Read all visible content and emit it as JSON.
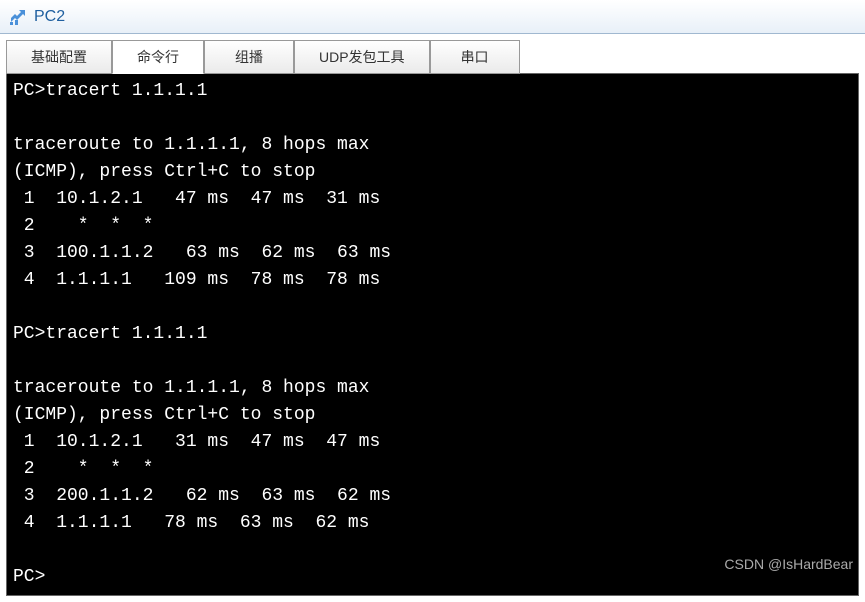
{
  "window": {
    "title": "PC2"
  },
  "tabs": [
    {
      "label": "基础配置",
      "active": false
    },
    {
      "label": "命令行",
      "active": true
    },
    {
      "label": "组播",
      "active": false
    },
    {
      "label": "UDP发包工具",
      "active": false
    },
    {
      "label": "串口",
      "active": false
    }
  ],
  "terminal": {
    "prompt": "PC>",
    "lines": [
      "PC>tracert 1.1.1.1",
      "",
      "traceroute to 1.1.1.1, 8 hops max",
      "(ICMP), press Ctrl+C to stop",
      " 1  10.1.2.1   47 ms  47 ms  31 ms",
      " 2    *  *  *",
      " 3  100.1.1.2   63 ms  62 ms  63 ms",
      " 4  1.1.1.1   109 ms  78 ms  78 ms",
      "",
      "PC>tracert 1.1.1.1",
      "",
      "traceroute to 1.1.1.1, 8 hops max",
      "(ICMP), press Ctrl+C to stop",
      " 1  10.1.2.1   31 ms  47 ms  47 ms",
      " 2    *  *  *",
      " 3  200.1.1.2   62 ms  63 ms  62 ms",
      " 4  1.1.1.1   78 ms  63 ms  62 ms",
      "",
      "PC>"
    ]
  },
  "watermark": "CSDN @IsHardBear"
}
